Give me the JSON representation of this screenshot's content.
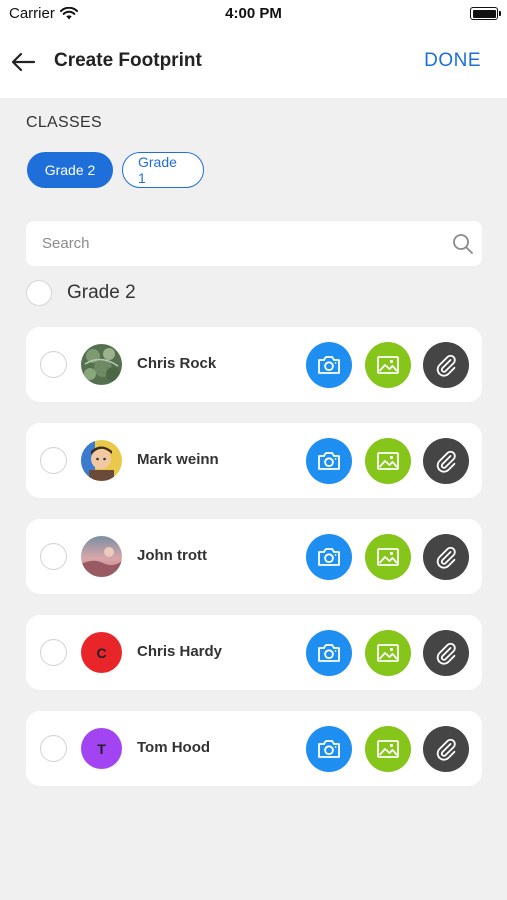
{
  "status_bar": {
    "carrier": "Carrier",
    "time": "4:00 PM",
    "battery_level": 1.0
  },
  "header": {
    "title": "Create Footprint",
    "done_label": "DONE"
  },
  "classes": {
    "label": "CLASSES",
    "chips": [
      {
        "label": "Grade 2",
        "selected": true
      },
      {
        "label": "Grade 1",
        "selected": false
      }
    ]
  },
  "search": {
    "placeholder": "Search",
    "value": ""
  },
  "group": {
    "label": "Grade 2",
    "checked": false
  },
  "students": [
    {
      "name": "Chris Rock",
      "avatar_type": "photo",
      "avatar_icon": "photo-foliage",
      "checked": false
    },
    {
      "name": "Mark weinn",
      "avatar_type": "photo",
      "avatar_icon": "photo-person",
      "checked": false
    },
    {
      "name": "John trott",
      "avatar_type": "photo",
      "avatar_icon": "photo-sunset",
      "checked": false
    },
    {
      "name": "Chris Hardy",
      "avatar_type": "initial",
      "initial": "C",
      "avatar_color": "#e8262a",
      "checked": false
    },
    {
      "name": "Tom Hood",
      "avatar_type": "initial",
      "initial": "T",
      "avatar_color": "#a244f2",
      "checked": false
    }
  ],
  "actions": [
    {
      "name": "camera-icon",
      "color": "#1e8ff0"
    },
    {
      "name": "image-gallery-icon",
      "color": "#86c51a"
    },
    {
      "name": "paperclip-icon",
      "color": "#454545"
    }
  ],
  "colors": {
    "accent": "#1e6fd9",
    "background": "#f0f0f0",
    "card": "#ffffff"
  }
}
